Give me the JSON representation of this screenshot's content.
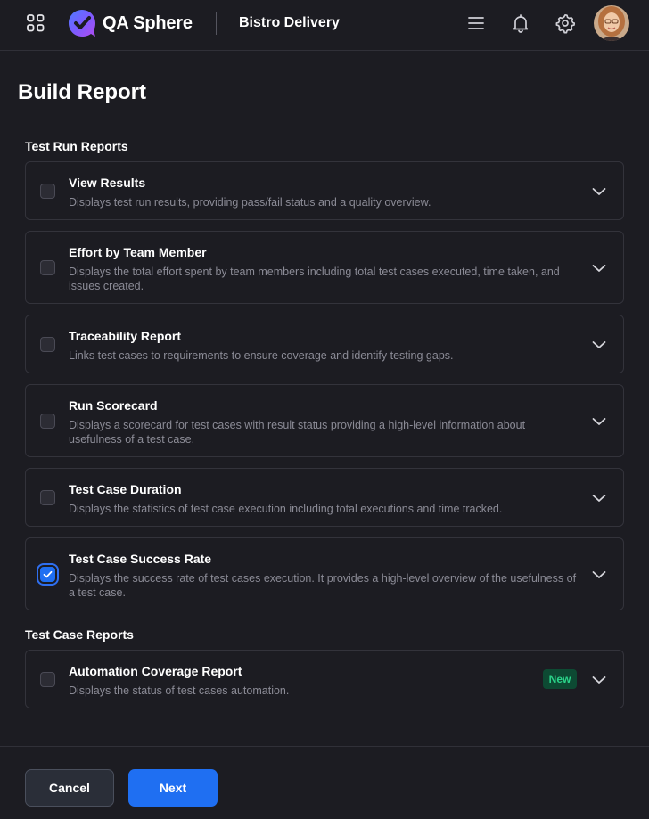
{
  "header": {
    "app_name": "QA Sphere",
    "project_name": "Bistro Delivery"
  },
  "page": {
    "title": "Build Report"
  },
  "sections": {
    "test_run": {
      "label": "Test Run Reports",
      "items": [
        {
          "title": "View Results",
          "description": "Displays test run results, providing pass/fail status and a quality overview.",
          "checked": false
        },
        {
          "title": "Effort by Team Member",
          "description": "Displays the total effort spent by team members including total test cases executed, time taken, and issues created.",
          "checked": false
        },
        {
          "title": "Traceability Report",
          "description": "Links test cases to requirements to ensure coverage and identify testing gaps.",
          "checked": false
        },
        {
          "title": "Run Scorecard",
          "description": "Displays a scorecard for test cases with result status providing a high-level information about usefulness of a test case.",
          "checked": false
        },
        {
          "title": "Test Case Duration",
          "description": "Displays the statistics of test case execution including total executions and time tracked.",
          "checked": false
        },
        {
          "title": "Test Case Success Rate",
          "description": "Displays the success rate of test cases execution. It provides a high-level overview of the usefulness of a test case.",
          "checked": true
        }
      ]
    },
    "test_case": {
      "label": "Test Case Reports",
      "items": [
        {
          "title": "Automation Coverage Report",
          "description": "Displays the status of test cases automation.",
          "checked": false,
          "badge": "New"
        }
      ]
    }
  },
  "footer": {
    "cancel_label": "Cancel",
    "next_label": "Next"
  },
  "colors": {
    "background": "#1c1c22",
    "primary": "#1f6ff2",
    "badge_bg": "#0d4a33",
    "badge_text": "#2bd48a"
  }
}
